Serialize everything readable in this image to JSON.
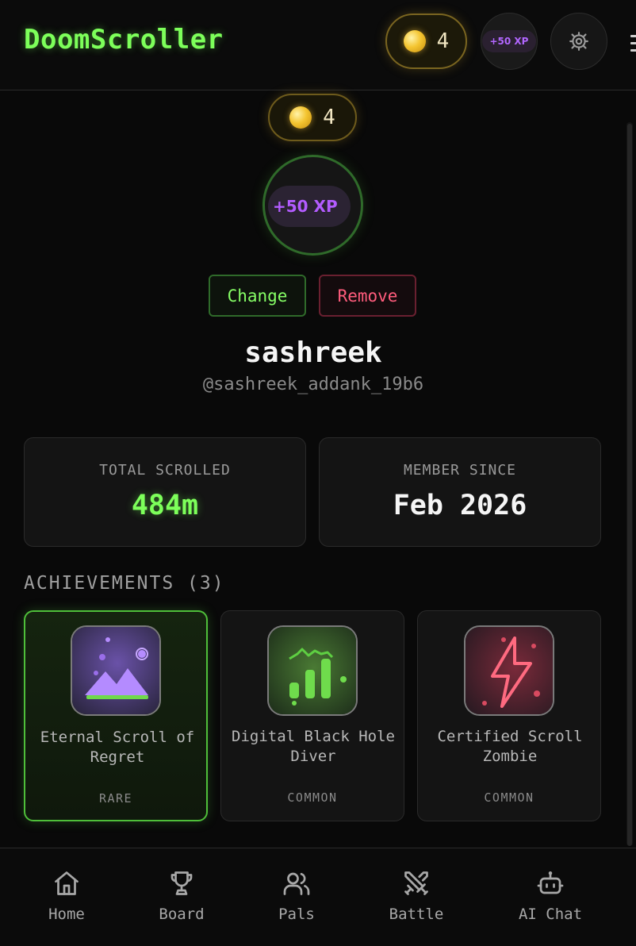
{
  "header": {
    "brand": "DoomScroller",
    "coins": "4",
    "xp_badge": "+50 XP",
    "settings_icon": "gear-icon",
    "menu_icon": "hamburger-icon"
  },
  "profile": {
    "coins": "4",
    "avatar_badge": "+50 XP",
    "change_label": "Change",
    "remove_label": "Remove",
    "username": "sashreek",
    "handle": "@sashreek_addank_19b6"
  },
  "stats": {
    "total_scrolled_label": "TOTAL SCROLLED",
    "total_scrolled_value": "484m",
    "member_since_label": "MEMBER SINCE",
    "member_since_value": "Feb 2026"
  },
  "achievements": {
    "heading": "ACHIEVEMENTS (3)",
    "items": [
      {
        "name": "Eternal Scroll of Regret",
        "rarity": "RARE",
        "icon": "mountain-image-icon"
      },
      {
        "name": "Digital Black Hole Diver",
        "rarity": "COMMON",
        "icon": "bar-chart-icon"
      },
      {
        "name": "Certified Scroll Zombie",
        "rarity": "COMMON",
        "icon": "lightning-icon"
      }
    ]
  },
  "nav": {
    "items": [
      {
        "label": "Home",
        "icon": "home-icon"
      },
      {
        "label": "Board",
        "icon": "trophy-icon"
      },
      {
        "label": "Pals",
        "icon": "users-icon"
      },
      {
        "label": "Battle",
        "icon": "swords-icon"
      },
      {
        "label": "AI Chat",
        "icon": "bot-icon"
      }
    ]
  },
  "colors": {
    "accent_green": "#7dff5a",
    "coin_gold": "#f4c531",
    "xp_purple": "#b35cff",
    "remove_red": "#ff5c7c",
    "background": "#090909"
  }
}
